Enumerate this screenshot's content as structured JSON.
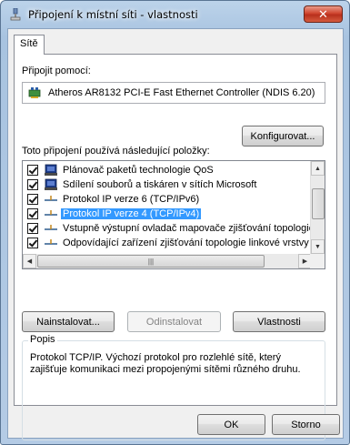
{
  "window": {
    "title": "Připojení k místní síti - vlastnosti",
    "close_symbol": "✕"
  },
  "tabs": [
    {
      "label": "Sítě"
    }
  ],
  "connect_using": {
    "label": "Připojit pomocí:",
    "adapter": "Atheros AR8132 PCI-E Fast Ethernet Controller (NDIS 6.20)"
  },
  "configure_button": "Konfigurovat...",
  "items_label": "Toto připojení používá následující položky:",
  "items": [
    {
      "label": "Plánovač paketů technologie QoS",
      "checked": true,
      "icon": "qos-scheduler-icon"
    },
    {
      "label": "Sdílení souborů a tiskáren v sítích Microsoft",
      "checked": true,
      "icon": "file-sharing-icon"
    },
    {
      "label": "Protokol IP verze 6 (TCP/IPv6)",
      "checked": true,
      "icon": "network-protocol-icon"
    },
    {
      "label": "Protokol IP verze 4 (TCP/IPv4)",
      "checked": true,
      "icon": "network-protocol-icon",
      "selected": true
    },
    {
      "label": "Vstupně výstupní ovladač mapovače zjišťování topologie",
      "checked": true,
      "icon": "network-protocol-icon"
    },
    {
      "label": "Odpovídající zařízení zjišťování topologie linkové vrstvy",
      "checked": true,
      "icon": "network-protocol-icon"
    }
  ],
  "scrollbar": {
    "h_thumb_grip": "|||"
  },
  "buttons": {
    "install": "Nainstalovat...",
    "uninstall": "Odinstalovat",
    "properties": "Vlastnosti",
    "ok": "OK",
    "cancel": "Storno"
  },
  "description": {
    "legend": "Popis",
    "text": "Protokol TCP/IP. Výchozí protokol pro rozlehlé sítě, který zajišťuje komunikaci mezi propojenými sítěmi různého druhu."
  }
}
